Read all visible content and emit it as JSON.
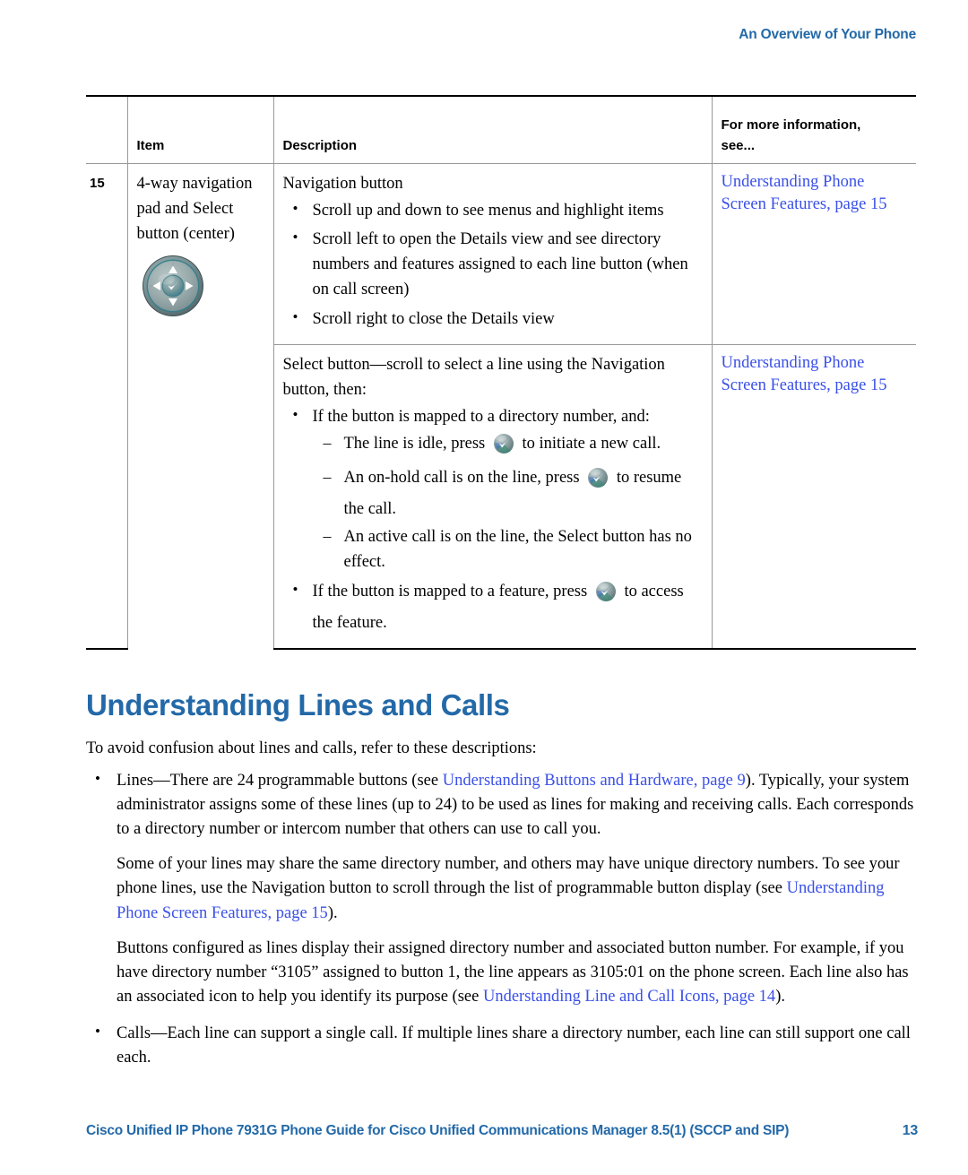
{
  "header": {
    "running_head": "An Overview of Your Phone"
  },
  "table": {
    "columns": [
      "Item",
      "Description",
      "For more information, see..."
    ],
    "headers": {
      "item_num": "",
      "item": "Item",
      "description": "Description",
      "more_info_line1": "For more information,",
      "more_info_line2": "see..."
    },
    "rows": [
      {
        "item_num": "15",
        "item_label": "4-way navigation pad and Select button (center)",
        "item_icon": "navigation-pad-icon",
        "desc_lead": "Navigation button",
        "bullets": [
          "Scroll up and down to see menus and highlight items",
          "Scroll left to open the Details view and see directory numbers and features assigned to each line button (when on call screen)",
          "Scroll right to close the Details view"
        ],
        "more_info": {
          "link_text": "Understanding Phone Screen Features,",
          "page_text": "page 15"
        }
      },
      {
        "item_num": "",
        "desc_lead": "Select button—scroll to select a line using the Navigation button, then:",
        "bullet_1_pre": "If the button is mapped to a directory number, and:",
        "sub_bullets": [
          {
            "pre": "The line is idle, press",
            "icon": "select-button-icon",
            "post": "to initiate a new call."
          },
          {
            "pre": "An on-hold call is on the line, press",
            "icon": "select-button-icon",
            "post": "to resume the call."
          },
          {
            "pre": "An active call is on the line, the Select button has no effect.",
            "icon": "",
            "post": ""
          }
        ],
        "bullet_2_pre": "If the button is mapped to a feature, press",
        "bullet_2_icon": "select-button-icon",
        "bullet_2_post": "to access the feature.",
        "more_info": {
          "link_text": "Understanding Phone Screen Features,",
          "page_text": "page 15"
        }
      }
    ]
  },
  "section": {
    "heading": "Understanding Lines and Calls",
    "intro": "To avoid confusion about lines and calls, refer to these descriptions:",
    "bullets": [
      {
        "paragraphs": [
          {
            "segments": [
              {
                "type": "text",
                "value": "Lines—There are 24 programmable buttons (see "
              },
              {
                "type": "link",
                "value": "Understanding Buttons and Hardware, page 9"
              },
              {
                "type": "text",
                "value": "). Typically, your system administrator assigns some of these lines (up to 24) to be used as lines for making and receiving calls. Each corresponds to a directory number or intercom number that others can use to call you."
              }
            ]
          },
          {
            "segments": [
              {
                "type": "text",
                "value": "Some of your lines may share the same directory number, and others may have unique directory numbers. To see your phone lines, use the Navigation button to scroll through the list of programmable button display (see "
              },
              {
                "type": "link",
                "value": "Understanding Phone Screen Features, page 15"
              },
              {
                "type": "text",
                "value": ")."
              }
            ]
          },
          {
            "segments": [
              {
                "type": "text",
                "value": "Buttons configured as lines display their assigned directory number and associated button number. For example, if you have directory number “3105” assigned to button 1, the line appears as 3105:01 on the phone screen. Each line also has an associated icon to help you identify its purpose (see "
              },
              {
                "type": "link",
                "value": "Understanding Line and Call Icons, page 14"
              },
              {
                "type": "text",
                "value": ")."
              }
            ]
          }
        ]
      },
      {
        "paragraphs": [
          {
            "segments": [
              {
                "type": "text",
                "value": "Calls—Each line can support a single call. If multiple lines share a directory number, each line can still support one call each."
              }
            ]
          }
        ]
      }
    ]
  },
  "footer": {
    "document_title": "Cisco Unified IP Phone 7931G Phone Guide for Cisco Unified Communications Manager 8.5(1) (SCCP and SIP)",
    "page_number": "13"
  },
  "colors": {
    "heading_blue": "#2369A8",
    "link_blue": "#3A50E8",
    "text_black": "#000000",
    "rule_black": "#000000",
    "rule_gray": "#999999"
  }
}
